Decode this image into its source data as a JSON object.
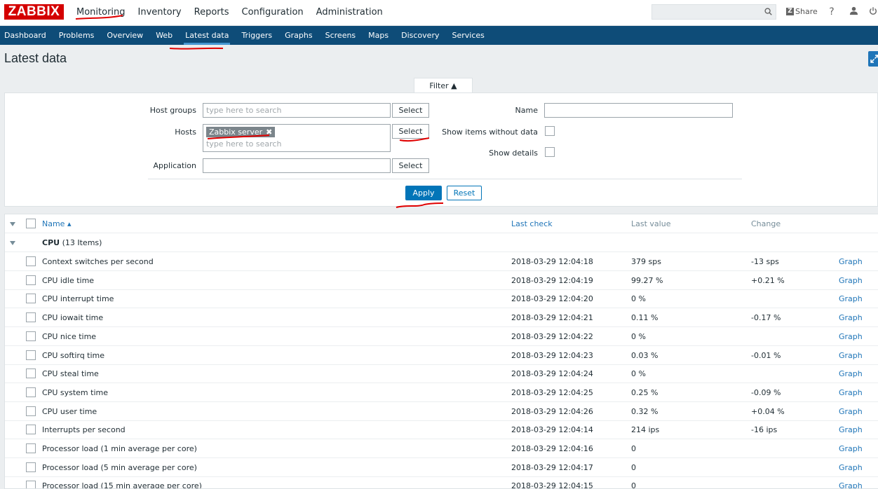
{
  "logo": "ZABBIX",
  "main_nav": [
    {
      "label": "Monitoring",
      "active": true
    },
    {
      "label": "Inventory",
      "active": false
    },
    {
      "label": "Reports",
      "active": false
    },
    {
      "label": "Configuration",
      "active": false
    },
    {
      "label": "Administration",
      "active": false
    }
  ],
  "header": {
    "search_value": "",
    "share_label": "Share",
    "help_label": "?"
  },
  "sub_nav": [
    {
      "label": "Dashboard",
      "active": false
    },
    {
      "label": "Problems",
      "active": false
    },
    {
      "label": "Overview",
      "active": false
    },
    {
      "label": "Web",
      "active": false
    },
    {
      "label": "Latest data",
      "active": true
    },
    {
      "label": "Triggers",
      "active": false
    },
    {
      "label": "Graphs",
      "active": false
    },
    {
      "label": "Screens",
      "active": false
    },
    {
      "label": "Maps",
      "active": false
    },
    {
      "label": "Discovery",
      "active": false
    },
    {
      "label": "Services",
      "active": false
    }
  ],
  "page_title": "Latest data",
  "filter": {
    "tab_label": "Filter ▲",
    "host_groups_label": "Host groups",
    "host_groups_placeholder": "type here to search",
    "hosts_label": "Hosts",
    "hosts_chip": "Zabbix server",
    "hosts_placeholder": "type here to search",
    "application_label": "Application",
    "application_value": "",
    "select_label": "Select",
    "name_label": "Name",
    "name_value": "",
    "show_without_data_label": "Show items without data",
    "show_details_label": "Show details",
    "apply_label": "Apply",
    "reset_label": "Reset"
  },
  "table": {
    "headers": {
      "name": "Name ▴",
      "last_check": "Last check",
      "last_value": "Last value",
      "change": "Change"
    },
    "group_name": "CPU",
    "group_count": "(13 Items)",
    "graph_label": "Graph",
    "rows": [
      {
        "name": "Context switches per second",
        "last_check": "2018-03-29 12:04:18",
        "last_value": "379 sps",
        "change": "-13 sps"
      },
      {
        "name": "CPU idle time",
        "last_check": "2018-03-29 12:04:19",
        "last_value": "99.27 %",
        "change": "+0.21 %"
      },
      {
        "name": "CPU interrupt time",
        "last_check": "2018-03-29 12:04:20",
        "last_value": "0 %",
        "change": ""
      },
      {
        "name": "CPU iowait time",
        "last_check": "2018-03-29 12:04:21",
        "last_value": "0.11 %",
        "change": "-0.17 %"
      },
      {
        "name": "CPU nice time",
        "last_check": "2018-03-29 12:04:22",
        "last_value": "0 %",
        "change": ""
      },
      {
        "name": "CPU softirq time",
        "last_check": "2018-03-29 12:04:23",
        "last_value": "0.03 %",
        "change": "-0.01 %"
      },
      {
        "name": "CPU steal time",
        "last_check": "2018-03-29 12:04:24",
        "last_value": "0 %",
        "change": ""
      },
      {
        "name": "CPU system time",
        "last_check": "2018-03-29 12:04:25",
        "last_value": "0.25 %",
        "change": "-0.09 %"
      },
      {
        "name": "CPU user time",
        "last_check": "2018-03-29 12:04:26",
        "last_value": "0.32 %",
        "change": "+0.04 %"
      },
      {
        "name": "Interrupts per second",
        "last_check": "2018-03-29 12:04:14",
        "last_value": "214 ips",
        "change": "-16 ips"
      },
      {
        "name": "Processor load (1 min average per core)",
        "last_check": "2018-03-29 12:04:16",
        "last_value": "0",
        "change": ""
      },
      {
        "name": "Processor load (5 min average per core)",
        "last_check": "2018-03-29 12:04:17",
        "last_value": "0",
        "change": ""
      },
      {
        "name": "Processor load (15 min average per core)",
        "last_check": "2018-03-29 12:04:15",
        "last_value": "0",
        "change": ""
      }
    ]
  },
  "colors": {
    "brand_red": "#d40000",
    "subnav_blue": "#0e4c78",
    "link_blue": "#1f75b8",
    "annotation_red": "#e00000"
  }
}
